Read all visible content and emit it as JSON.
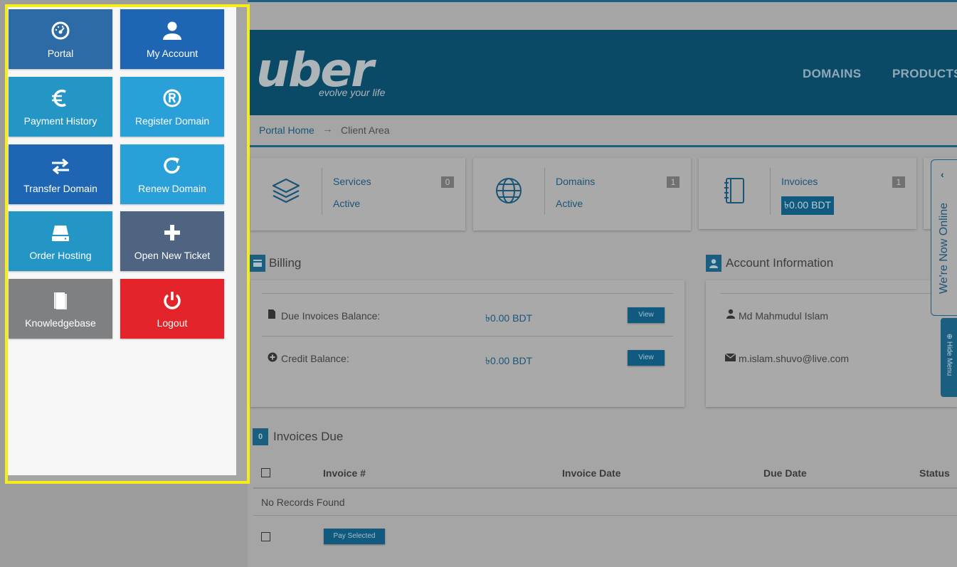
{
  "brand": {
    "logo": "uber",
    "tagline": "evolve your life"
  },
  "nav": {
    "domains": "DOMAINS",
    "products": "PRODUCTS"
  },
  "breadcrumb": {
    "home": "Portal Home",
    "arrow": "→",
    "current": "Client Area"
  },
  "stats": [
    {
      "label": "Services",
      "sub": "Active",
      "count": "0",
      "icon": "layers-icon"
    },
    {
      "label": "Domains",
      "sub": "Active",
      "count": "1",
      "icon": "globe-icon"
    },
    {
      "label": "Invoices",
      "sub": "৳0.00 BDT",
      "count": "1",
      "icon": "notebook-icon"
    }
  ],
  "billing": {
    "title": "Billing",
    "due_label": "Due Invoices Balance:",
    "due_amount": "৳0.00 BDT",
    "credit_label": "Credit Balance:",
    "credit_amount": "৳0.00 BDT",
    "view": "View"
  },
  "account": {
    "title": "Account Information",
    "name": "Md Mahmudul Islam",
    "email": "m.islam.shuvo@live.com"
  },
  "invoices_due": {
    "count": "0",
    "title": "Invoices Due",
    "columns": [
      "Invoice #",
      "Invoice Date",
      "Due Date",
      "Status"
    ],
    "empty": "No Records Found",
    "pay_selected": "Pay Selected"
  },
  "chat": {
    "text": "We're Now Online",
    "chevron": "‹"
  },
  "hide_menu": "Hide Menu",
  "menu": {
    "tiles": [
      {
        "label": "Portal",
        "icon": "dashboard-icon",
        "color": "#2d6ba7"
      },
      {
        "label": "My Account",
        "icon": "user-icon",
        "color": "#1e66b3"
      },
      {
        "label": "Payment History",
        "icon": "euro-icon",
        "color": "#2496c6"
      },
      {
        "label": "Register Domain",
        "icon": "registered-icon",
        "color": "#2aa0d8"
      },
      {
        "label": "Transfer Domain",
        "icon": "transfer-icon",
        "color": "#1e66b3"
      },
      {
        "label": "Renew Domain",
        "icon": "refresh-icon",
        "color": "#2aa0d8"
      },
      {
        "label": "Order Hosting",
        "icon": "server-icon",
        "color": "#2496c6"
      },
      {
        "label": "Open New Ticket",
        "icon": "plus-icon",
        "color": "#4e6480"
      },
      {
        "label": "Knowledgebase",
        "icon": "book-icon",
        "color": "#7e8082"
      },
      {
        "label": "Logout",
        "icon": "power-icon",
        "color": "#e3252b"
      }
    ]
  },
  "colors": {
    "highlight_border": "#f5ee16",
    "header_bg": "#0b4a66"
  }
}
